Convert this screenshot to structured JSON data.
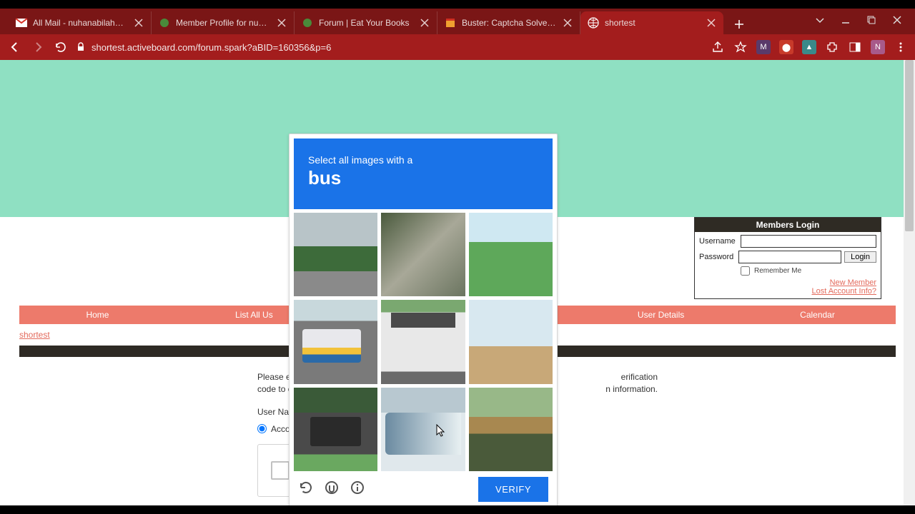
{
  "browser": {
    "tabs": [
      {
        "label": "All Mail - nuhanabilahhaik@",
        "favicon": "gmail"
      },
      {
        "label": "Member Profile for nuhanab",
        "favicon": "leaf"
      },
      {
        "label": "Forum | Eat Your Books",
        "favicon": "leaf"
      },
      {
        "label": "Buster: Captcha Solver for H",
        "favicon": "store"
      },
      {
        "label": "shortest",
        "favicon": "globe",
        "active": true
      }
    ],
    "url": "shortest.activeboard.com/forum.spark?aBID=160356&p=6"
  },
  "login": {
    "title": "Members Login",
    "username_label": "Username",
    "password_label": "Password",
    "login_btn": "Login",
    "remember": "Remember Me",
    "new_member": "New Member",
    "lost": "Lost Account Info?"
  },
  "nav": {
    "items": [
      "Home",
      "List All Us",
      "User Details",
      "Calendar"
    ],
    "crumb": "shortest"
  },
  "form": {
    "hint_a": "Please en",
    "hint_b": "erification",
    "hint_c": "code to e",
    "hint_d": "n information.",
    "username_label": "User Nan",
    "radio_label": "Acco"
  },
  "captcha": {
    "line1": "Select all images with a",
    "keyword": "bus",
    "verify": "VERIFY"
  }
}
